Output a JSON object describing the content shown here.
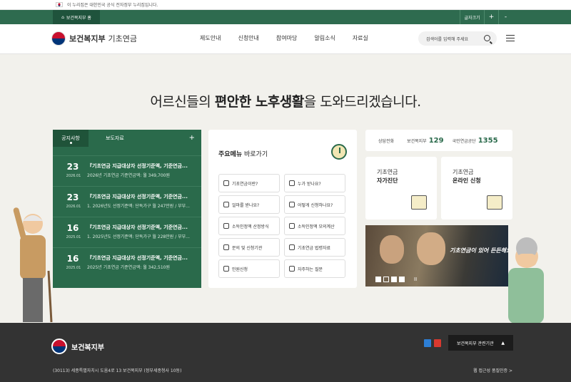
{
  "gov_banner": {
    "text": "이 누리집은 대한민국 공식 전자정부 누리집입니다."
  },
  "topbar": {
    "home": "보건복지부 홈",
    "font_label": "글자크기",
    "plus": "+",
    "minus": "-"
  },
  "header": {
    "logo_org": "보건복지부",
    "logo_service": "기초연금",
    "nav": [
      "제도안내",
      "신청안내",
      "참여마당",
      "알림소식",
      "자료실"
    ],
    "search_placeholder": "검색어를 입력해 주세요"
  },
  "hero": {
    "pre": "어르신들의 ",
    "bold1": "편안한 노후생활",
    "post": "을 도와드리겠습니다."
  },
  "notice": {
    "tab_active": "공지사항",
    "tab_other": "보도자료",
    "more": "+",
    "items": [
      {
        "day": "23",
        "ym": "2026.01",
        "title": "『기초연금 지급대상자 선정기준액, 기준연금...",
        "sub": "2026년 기초연금 기준연금액: 월 349,700원"
      },
      {
        "day": "23",
        "ym": "2026.01",
        "title": "『기초연금 지급대상자 선정기준액, 기준연금...",
        "sub": "1. 2026년도 선정기준액: 단독가구 월 247만원 / 부부..."
      },
      {
        "day": "16",
        "ym": "2025.01",
        "title": "『기초연금 지급대상자 선정기준액, 기준연금...",
        "sub": "1. 2025년도 선정기준액: 단독가구 월 228만원 / 부부..."
      },
      {
        "day": "16",
        "ym": "2025.01",
        "title": "『기초연금 지급대상자 선정기준액, 기준연금...",
        "sub": "2025년 기초연금 기준연금액: 월 342,510원"
      }
    ]
  },
  "menu": {
    "title_bold": "주요메뉴",
    "title_rest": " 바로가기",
    "items": [
      "기초연금이란?",
      "누가 받나요?",
      "얼마를 받나요?",
      "어떻게 신청하나요?",
      "소득인정액 산정방식",
      "소득인정액 모의계산",
      "문의 및 신청기관",
      "기초연금 법령자료",
      "민원신청",
      "자주하는 질문"
    ]
  },
  "contact": {
    "label": "상담전화",
    "mohw": "보건복지부",
    "mohw_num": "129",
    "nps": "국민연금공단",
    "nps_num": "1355"
  },
  "services": [
    {
      "line1": "기초연금",
      "line2": "자가진단"
    },
    {
      "line1": "기초연금",
      "line2": "온라인 신청"
    }
  ],
  "banner": {
    "caption": "기초연금이 있어 든든해요!",
    "pause": "II"
  },
  "footer": {
    "org": "보건복지부",
    "related": "보건복지부 관련기관",
    "related_arrow": "▲",
    "address": "(30113) 세종특별자치시 도움4로 13 보건복지부 (정부세종청사 10동)",
    "accessibility": "웹 접근성 품질인증 >"
  },
  "colors": {
    "brand_green": "#2e6b4f",
    "dark_green": "#1f533c",
    "footer": "#333333"
  }
}
